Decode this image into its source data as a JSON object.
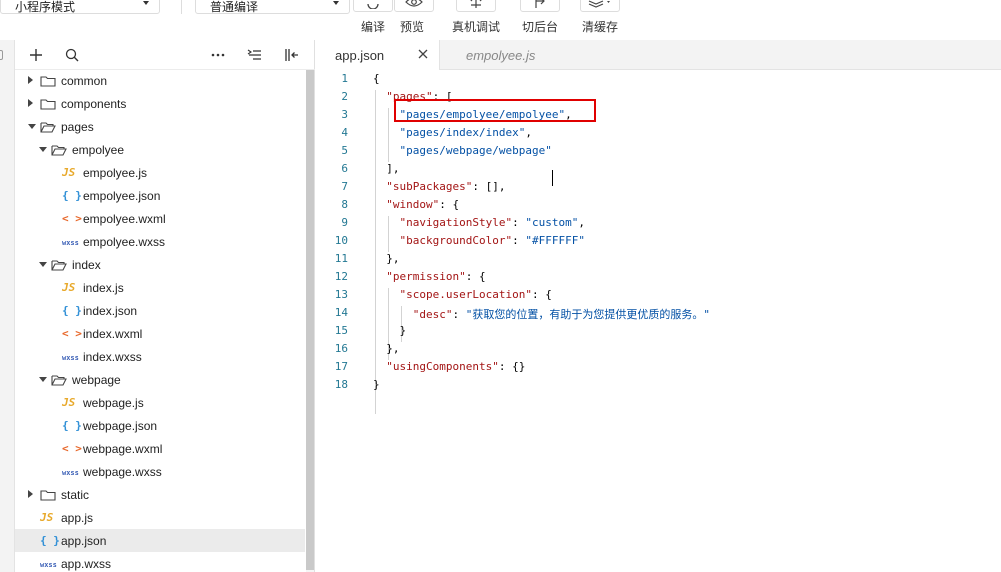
{
  "toolbar": {
    "mode_select": "小程序模式",
    "compile_select": "普通编译",
    "buttons": [
      {
        "label": "编译",
        "icon": "refresh-icon"
      },
      {
        "label": "预览",
        "icon": "eye-icon"
      },
      {
        "label": "真机调试",
        "icon": "bug-icon"
      },
      {
        "label": "切后台",
        "icon": "switch-background-icon"
      },
      {
        "label": "清缓存",
        "icon": "layers-icon"
      }
    ]
  },
  "explorer": {
    "header_icons": [
      "plus-icon",
      "search-icon",
      "more-icon",
      "sort-icon",
      "collapse-panel-icon"
    ],
    "tree": [
      {
        "label": "common",
        "type": "folder",
        "state": "collapsed"
      },
      {
        "label": "components",
        "type": "folder",
        "state": "collapsed"
      },
      {
        "label": "pages",
        "type": "folder",
        "state": "expanded"
      },
      {
        "label": "empolyee",
        "type": "folder",
        "state": "expanded"
      },
      {
        "label": "empolyee.js",
        "type": "js",
        "icon_text": "JS"
      },
      {
        "label": "empolyee.json",
        "type": "json",
        "icon_text": "{ }"
      },
      {
        "label": "empolyee.wxml",
        "type": "wxml",
        "icon_text": "< >"
      },
      {
        "label": "empolyee.wxss",
        "type": "wxss",
        "icon_text": "wxss"
      },
      {
        "label": "index",
        "type": "folder",
        "state": "expanded"
      },
      {
        "label": "index.js",
        "type": "js",
        "icon_text": "JS"
      },
      {
        "label": "index.json",
        "type": "json",
        "icon_text": "{ }"
      },
      {
        "label": "index.wxml",
        "type": "wxml",
        "icon_text": "< >"
      },
      {
        "label": "index.wxss",
        "type": "wxss",
        "icon_text": "wxss"
      },
      {
        "label": "webpage",
        "type": "folder",
        "state": "expanded"
      },
      {
        "label": "webpage.js",
        "type": "js",
        "icon_text": "JS"
      },
      {
        "label": "webpage.json",
        "type": "json",
        "icon_text": "{ }"
      },
      {
        "label": "webpage.wxml",
        "type": "wxml",
        "icon_text": "< >"
      },
      {
        "label": "webpage.wxss",
        "type": "wxss",
        "icon_text": "wxss"
      },
      {
        "label": "static",
        "type": "folder",
        "state": "collapsed"
      },
      {
        "label": "app.js",
        "type": "js",
        "icon_text": "JS"
      },
      {
        "label": "app.json",
        "type": "json",
        "icon_text": "{ }",
        "selected": true
      },
      {
        "label": "app.wxss",
        "type": "wxss",
        "icon_text": "wxss"
      }
    ]
  },
  "editor": {
    "tabs": [
      {
        "label": "app.json",
        "active": true
      },
      {
        "label": "empolyee.js",
        "active": false
      }
    ],
    "lines": [
      {
        "n": "1",
        "text": "{"
      },
      {
        "n": "2",
        "text": "  \"pages\": ["
      },
      {
        "n": "3",
        "text": "    \"pages/empolyee/empolyee\","
      },
      {
        "n": "4",
        "text": "    \"pages/index/index\","
      },
      {
        "n": "5",
        "text": "    \"pages/webpage/webpage\""
      },
      {
        "n": "6",
        "text": "  ],"
      },
      {
        "n": "7",
        "text": "  \"subPackages\": [],"
      },
      {
        "n": "8",
        "text": "  \"window\": {"
      },
      {
        "n": "9",
        "text": "    \"navigationStyle\": \"custom\","
      },
      {
        "n": "10",
        "text": "    \"backgroundColor\": \"#FFFFFF\""
      },
      {
        "n": "11",
        "text": "  },"
      },
      {
        "n": "12",
        "text": "  \"permission\": {"
      },
      {
        "n": "13",
        "text": "    \"scope.userLocation\": {"
      },
      {
        "n": "14",
        "text": "      \"desc\": \"获取您的位置，有助于为您提供更优质的服务。\""
      },
      {
        "n": "15",
        "text": "    }"
      },
      {
        "n": "16",
        "text": "  },"
      },
      {
        "n": "17",
        "text": "  \"usingComponents\": {}"
      },
      {
        "n": "18",
        "text": "}"
      }
    ]
  },
  "colors": {
    "json_key": "#a31515",
    "json_string": "#0451a5",
    "line_number": "#237893",
    "highlight_box": "#e00000",
    "js_icon": "#e8a92b",
    "json_icon": "#2f8fd6",
    "wxml_icon": "#e8682b",
    "wxss_icon": "#3f63b8"
  }
}
